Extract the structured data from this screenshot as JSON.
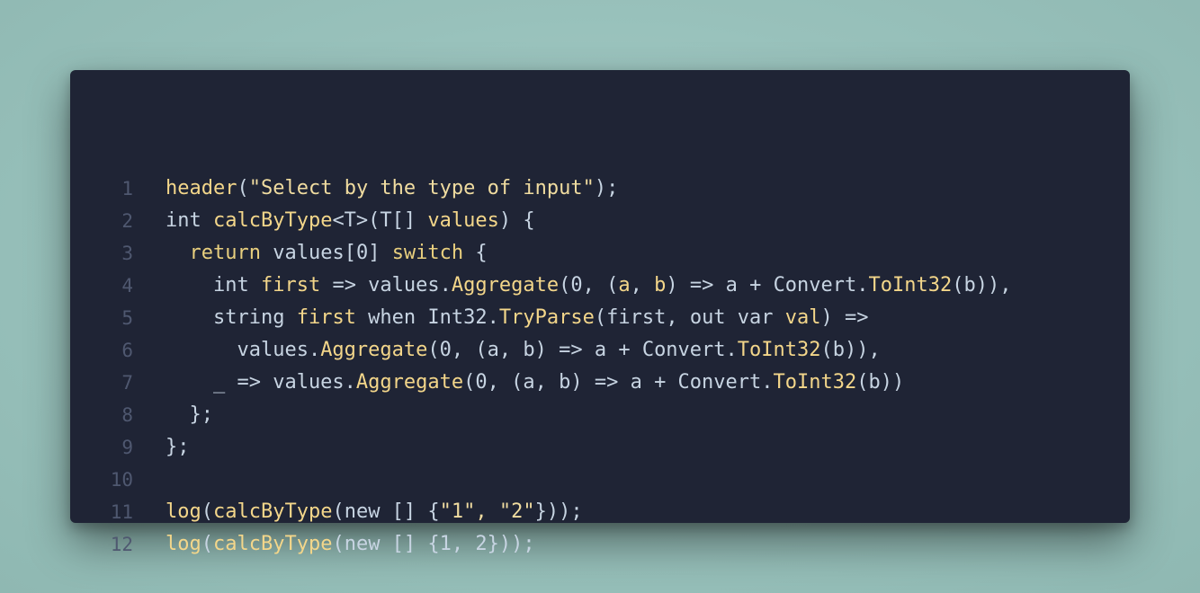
{
  "colors": {
    "background": "#9ac3bd",
    "card": "#1f2435",
    "line_number": "#4f5870",
    "plain": "#c7d4e2",
    "function": "#f3d68a",
    "keyword": "#e8cf7e"
  },
  "lines": [
    {
      "num": "1",
      "segments": [
        {
          "t": "header",
          "c": "fn"
        },
        {
          "t": "(",
          "c": "id"
        },
        {
          "t": "\"Select by the type of input\"",
          "c": "str"
        },
        {
          "t": ");",
          "c": "id"
        }
      ]
    },
    {
      "num": "2",
      "segments": [
        {
          "t": "int ",
          "c": "id"
        },
        {
          "t": "calcByType",
          "c": "fn"
        },
        {
          "t": "<T>(T[] ",
          "c": "id"
        },
        {
          "t": "values",
          "c": "fn"
        },
        {
          "t": ") {",
          "c": "id"
        }
      ]
    },
    {
      "num": "3",
      "segments": [
        {
          "t": "  ",
          "c": "id"
        },
        {
          "t": "return",
          "c": "kw"
        },
        {
          "t": " values[0] ",
          "c": "id"
        },
        {
          "t": "switch",
          "c": "kw"
        },
        {
          "t": " {",
          "c": "id"
        }
      ]
    },
    {
      "num": "4",
      "segments": [
        {
          "t": "    int ",
          "c": "id"
        },
        {
          "t": "first",
          "c": "fn"
        },
        {
          "t": " => values.",
          "c": "id"
        },
        {
          "t": "Aggregate",
          "c": "fn"
        },
        {
          "t": "(0, (",
          "c": "id"
        },
        {
          "t": "a",
          "c": "fn"
        },
        {
          "t": ", ",
          "c": "id"
        },
        {
          "t": "b",
          "c": "fn"
        },
        {
          "t": ") => a + Convert.",
          "c": "id"
        },
        {
          "t": "ToInt32",
          "c": "fn"
        },
        {
          "t": "(b)),",
          "c": "id"
        }
      ]
    },
    {
      "num": "5",
      "segments": [
        {
          "t": "    string ",
          "c": "id"
        },
        {
          "t": "first",
          "c": "fn"
        },
        {
          "t": " when Int32.",
          "c": "id"
        },
        {
          "t": "TryParse",
          "c": "fn"
        },
        {
          "t": "(first, out var ",
          "c": "id"
        },
        {
          "t": "val",
          "c": "fn"
        },
        {
          "t": ") =>",
          "c": "id"
        }
      ]
    },
    {
      "num": "6",
      "segments": [
        {
          "t": "      values.",
          "c": "id"
        },
        {
          "t": "Aggregate",
          "c": "fn"
        },
        {
          "t": "(0, (a, b) => a + Convert.",
          "c": "id"
        },
        {
          "t": "ToInt32",
          "c": "fn"
        },
        {
          "t": "(b)),",
          "c": "id"
        }
      ]
    },
    {
      "num": "7",
      "segments": [
        {
          "t": "    _ => values.",
          "c": "id"
        },
        {
          "t": "Aggregate",
          "c": "fn"
        },
        {
          "t": "(0, (a, b) => a + Convert.",
          "c": "id"
        },
        {
          "t": "ToInt32",
          "c": "fn"
        },
        {
          "t": "(b))",
          "c": "id"
        }
      ]
    },
    {
      "num": "8",
      "segments": [
        {
          "t": "  };",
          "c": "id"
        }
      ]
    },
    {
      "num": "9",
      "segments": [
        {
          "t": "};",
          "c": "id"
        }
      ]
    },
    {
      "num": "10",
      "segments": []
    },
    {
      "num": "11",
      "segments": [
        {
          "t": "log",
          "c": "fn"
        },
        {
          "t": "(",
          "c": "id"
        },
        {
          "t": "calcByType",
          "c": "fn"
        },
        {
          "t": "(new [] {",
          "c": "id"
        },
        {
          "t": "\"1\", \"2\"",
          "c": "str"
        },
        {
          "t": "}));",
          "c": "id"
        }
      ]
    },
    {
      "num": "12",
      "segments": [
        {
          "t": "log",
          "c": "fn"
        },
        {
          "t": "(",
          "c": "id"
        },
        {
          "t": "calcByType",
          "c": "fn"
        },
        {
          "t": "(new [] {1, 2}));",
          "c": "id"
        }
      ]
    }
  ]
}
